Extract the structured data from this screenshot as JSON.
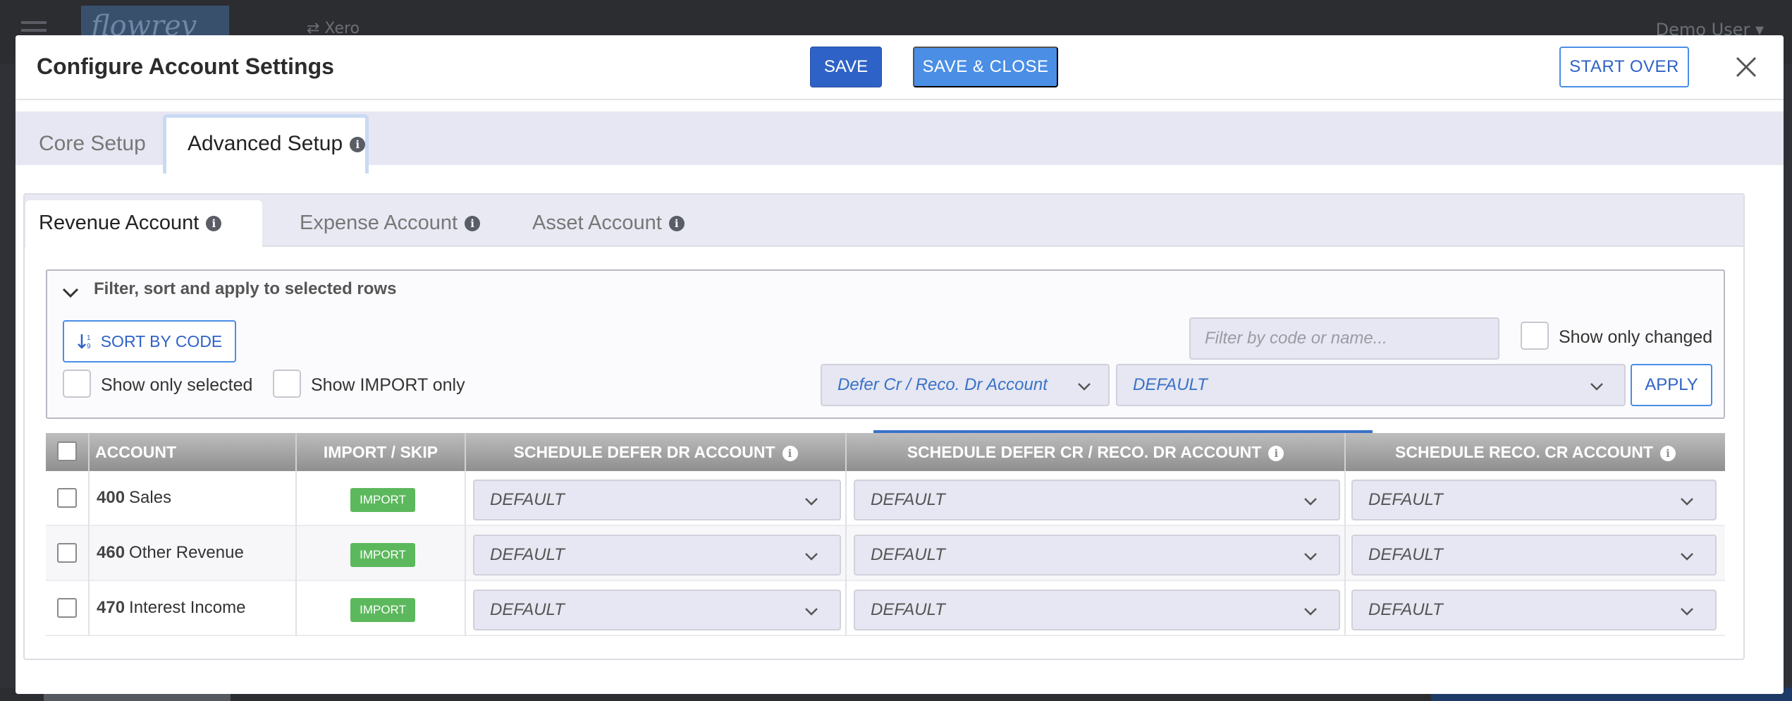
{
  "background": {
    "logo": "flowrev",
    "integration": "⇄ Xero",
    "user": "Demo User ▾"
  },
  "modal": {
    "title": "Configure Account Settings",
    "save_label": "SAVE",
    "save_close_label": "SAVE & CLOSE",
    "start_over_label": "START OVER"
  },
  "top_tabs": {
    "core": "Core Setup",
    "advanced": "Advanced Setup"
  },
  "sub_tabs": {
    "revenue": "Revenue Account",
    "expense": "Expense Account",
    "asset": "Asset Account"
  },
  "filter": {
    "title": "Filter, sort and apply to selected rows",
    "sort_label": "SORT BY CODE",
    "show_selected": "Show only selected",
    "show_import": "Show IMPORT only",
    "show_changed": "Show only changed",
    "search_placeholder": "Filter by code or name...",
    "column_select": "Defer Cr / Reco. Dr Account",
    "value_select": "DEFAULT",
    "apply_label": "APPLY"
  },
  "table": {
    "headers": {
      "account": "ACCOUNT",
      "import_skip": "IMPORT / SKIP",
      "defer_dr": "SCHEDULE DEFER DR ACCOUNT",
      "defer_cr": "SCHEDULE DEFER CR / RECO. DR ACCOUNT",
      "reco_cr": "SCHEDULE RECO. CR ACCOUNT"
    },
    "rows": [
      {
        "code": "400",
        "name": "Sales",
        "status": "IMPORT",
        "defer_dr": "DEFAULT",
        "defer_cr": "DEFAULT",
        "reco_cr": "DEFAULT"
      },
      {
        "code": "460",
        "name": "Other Revenue",
        "status": "IMPORT",
        "defer_dr": "DEFAULT",
        "defer_cr": "DEFAULT",
        "reco_cr": "DEFAULT"
      },
      {
        "code": "470",
        "name": "Interest Income",
        "status": "IMPORT",
        "defer_dr": "DEFAULT",
        "defer_cr": "DEFAULT",
        "reco_cr": "DEFAULT"
      }
    ]
  },
  "colors": {
    "primary": "#2f62c6",
    "accent": "#4a8ee6",
    "import_badge": "#5cb85c",
    "select_text": "#3a72c7"
  }
}
